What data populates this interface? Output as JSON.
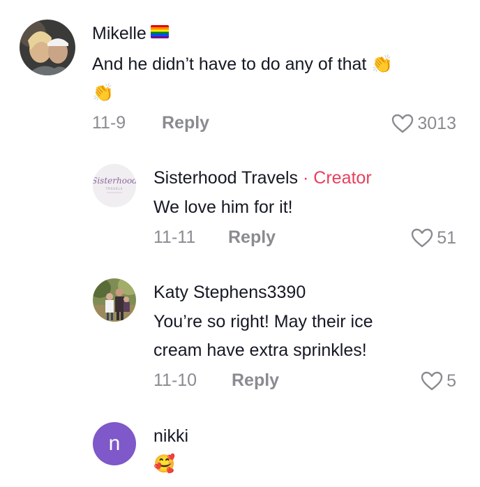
{
  "comments": [
    {
      "username": "Mikelle",
      "text_line1": "And he didn’t have to do any of that",
      "emoji1": "👏",
      "emoji2": "👏",
      "date": "11-9",
      "reply_label": "Reply",
      "likes": "3013"
    }
  ],
  "replies": [
    {
      "username": "Sisterhood Travels",
      "separator": "·",
      "badge": "Creator",
      "text": "We love him for it!",
      "date": "11-11",
      "reply_label": "Reply",
      "likes": "51",
      "avatar_text": "Sisterhood",
      "avatar_subtext": "TRAVELS"
    },
    {
      "username": "Katy Stephens3390",
      "text_line1": "You’re so right! May their ice",
      "text_line2": "cream have extra sprinkles!",
      "date": "11-10",
      "reply_label": "Reply",
      "likes": "5"
    },
    {
      "username": "nikki",
      "avatar_letter": "n",
      "emoji": "🥰"
    }
  ],
  "colors": {
    "creator": "#e6405e",
    "meta": "#8a8b91",
    "nikki_avatar": "#7f58c9"
  }
}
